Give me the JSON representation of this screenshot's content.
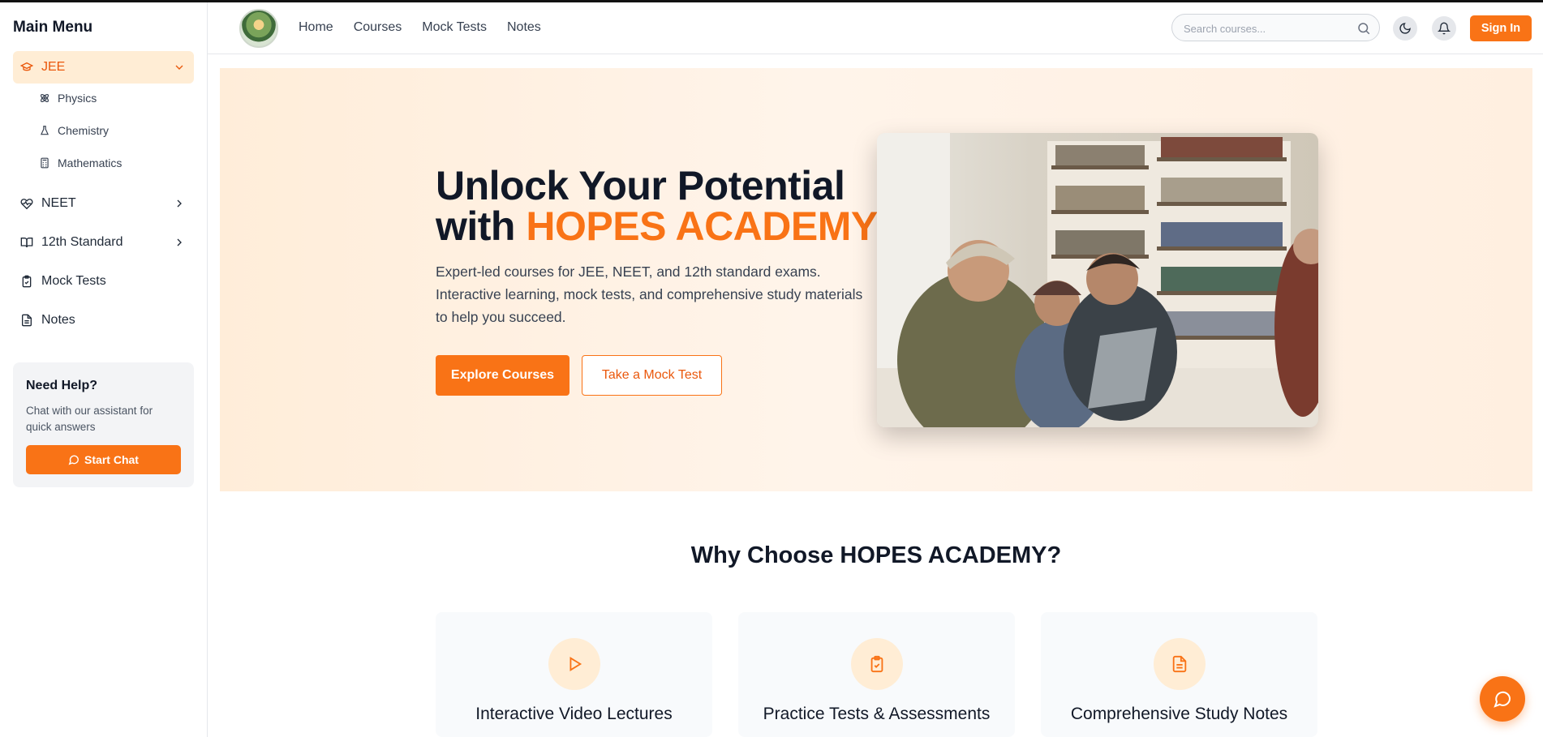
{
  "sidebar": {
    "title": "Main Menu",
    "items": [
      {
        "label": "JEE",
        "icon": "graduation-cap-icon"
      },
      {
        "label": "NEET",
        "icon": "heart-pulse-icon"
      },
      {
        "label": "12th Standard",
        "icon": "book-open-icon"
      },
      {
        "label": "Mock Tests",
        "icon": "clipboard-check-icon"
      },
      {
        "label": "Notes",
        "icon": "file-text-icon"
      }
    ],
    "jee_subitems": [
      {
        "label": "Physics",
        "icon": "atom-icon"
      },
      {
        "label": "Chemistry",
        "icon": "flask-icon"
      },
      {
        "label": "Mathematics",
        "icon": "calculator-icon"
      }
    ],
    "help": {
      "title": "Need Help?",
      "text": "Chat with our assistant for quick answers",
      "button": "Start Chat"
    }
  },
  "header": {
    "nav": [
      "Home",
      "Courses",
      "Mock Tests",
      "Notes"
    ],
    "search_placeholder": "Search courses...",
    "sign_in": "Sign In"
  },
  "hero": {
    "title_line1": "Unlock Your Potential",
    "title_with": "with ",
    "title_accent": "HOPES ACADEMY",
    "description": "Expert-led courses for JEE, NEET, and 12th standard exams. Interactive learning, mock tests, and comprehensive study materials to help you succeed.",
    "primary_button": "Explore Courses",
    "secondary_button": "Take a Mock Test"
  },
  "features": {
    "heading": "Why Choose HOPES ACADEMY?",
    "cards": [
      {
        "title": "Interactive Video Lectures",
        "icon": "play-icon"
      },
      {
        "title": "Practice Tests & Assessments",
        "icon": "clipboard-check-icon"
      },
      {
        "title": "Comprehensive Study Notes",
        "icon": "file-text-icon"
      }
    ]
  },
  "colors": {
    "accent": "#f97316",
    "accent_light": "#ffedd5",
    "text_dark": "#111827"
  }
}
